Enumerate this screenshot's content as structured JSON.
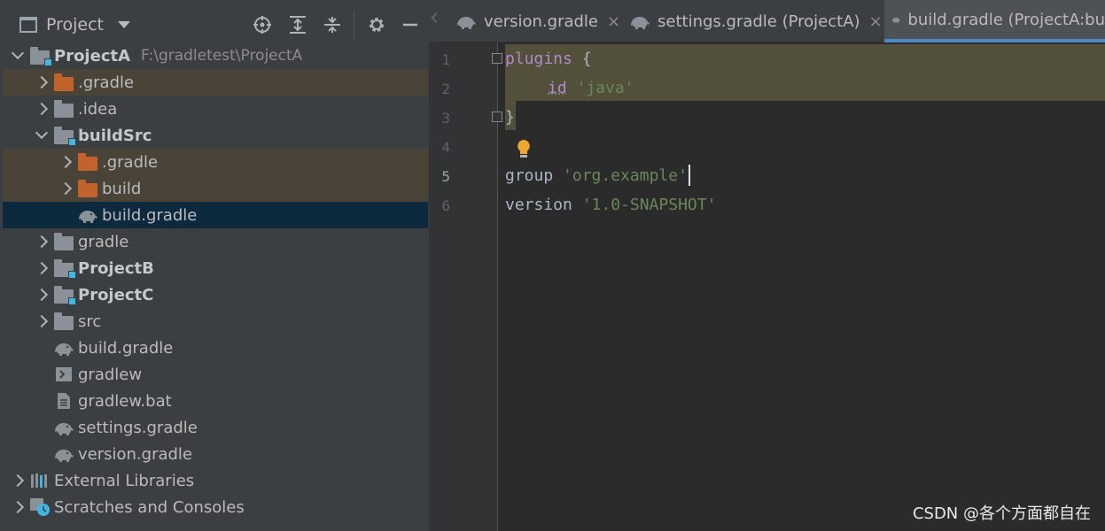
{
  "project_panel": {
    "title": "Project",
    "tree": [
      {
        "label": "ProjectA",
        "path": "F:\\gradletest\\ProjectA",
        "bold": true,
        "type": "module"
      },
      {
        "label": ".gradle",
        "type": "folder-orange"
      },
      {
        "label": ".idea",
        "type": "folder"
      },
      {
        "label": "buildSrc",
        "bold": true,
        "type": "module"
      },
      {
        "label": ".gradle",
        "type": "folder-orange"
      },
      {
        "label": "build",
        "type": "folder-orange"
      },
      {
        "label": "build.gradle",
        "type": "gradle",
        "selected": true
      },
      {
        "label": "gradle",
        "type": "folder"
      },
      {
        "label": "ProjectB",
        "bold": true,
        "type": "module"
      },
      {
        "label": "ProjectC",
        "bold": true,
        "type": "module"
      },
      {
        "label": "src",
        "type": "folder"
      },
      {
        "label": "build.gradle",
        "type": "gradle"
      },
      {
        "label": "gradlew",
        "type": "script"
      },
      {
        "label": "gradlew.bat",
        "type": "text"
      },
      {
        "label": "settings.gradle",
        "type": "gradle"
      },
      {
        "label": "version.gradle",
        "type": "gradle"
      },
      {
        "label": "External Libraries",
        "type": "libraries"
      },
      {
        "label": "Scratches and Consoles",
        "type": "scratches"
      }
    ]
  },
  "tabs": [
    {
      "label": "version.gradle",
      "close": "×"
    },
    {
      "label": "settings.gradle (ProjectA)",
      "close": "×"
    },
    {
      "label": "build.gradle (ProjectA:bu",
      "active": true
    }
  ],
  "editor": {
    "line_numbers": [
      "1",
      "2",
      "3",
      "4",
      "5",
      "6"
    ],
    "current_line": "5",
    "lines": {
      "l1_kw": "plugins",
      "l1_brace": " {",
      "l2_fn": "id",
      "l2_str": "'java'",
      "l3_brace": "}",
      "l5_kw": "group",
      "l5_str": "'org.example'",
      "l6_kw": "version",
      "l6_str": "'1.0-SNAPSHOT'"
    }
  },
  "watermark": "CSDN @各个方面都自在",
  "colors": {
    "panel_bg": "#3c3f41",
    "editor_bg": "#2b2b2b",
    "selection": "#0d293e",
    "excluded_bg": "#4a4338",
    "highlight_block": "#52503a",
    "string": "#6a8759",
    "keyword": "#cc7832",
    "tab_underline": "#4a88c7"
  }
}
